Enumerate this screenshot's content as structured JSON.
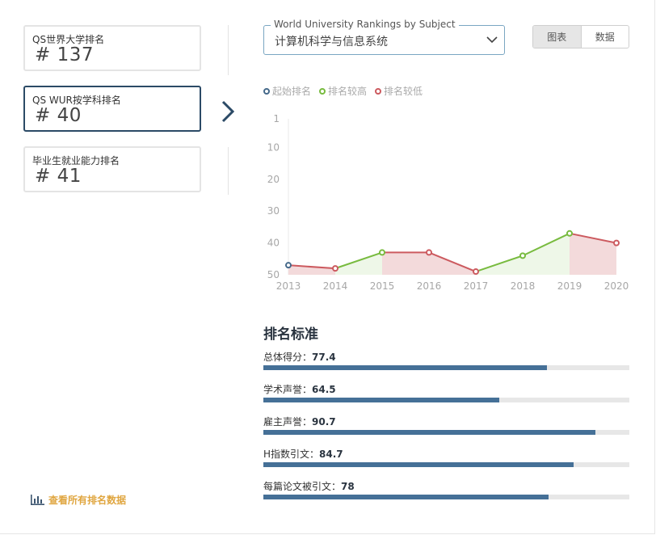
{
  "rank_cards": [
    {
      "label": "QS世界大学排名",
      "value": "# 137"
    },
    {
      "label": "QS WUR按学科排名",
      "value": "# 40"
    },
    {
      "label": "毕业生就业能力排名",
      "value": "# 41"
    }
  ],
  "subject_select": {
    "legend": "World University Rankings by Subject",
    "value": "计算机科学与信息系统"
  },
  "view_toggle": {
    "chart": "图表",
    "data": "数据"
  },
  "chart_legend": {
    "start": "起始排名",
    "higher": "排名较高",
    "lower": "排名较低"
  },
  "colors": {
    "start": "#45698a",
    "higher": "#78bb3f",
    "lower": "#cc5a5f",
    "higher_fill": "#eef7e8",
    "lower_fill": "#f3dadb",
    "bar": "#457097",
    "accent": "#e0a640"
  },
  "chart_data": {
    "type": "line",
    "x": [
      "2013",
      "2014",
      "2015",
      "2016",
      "2017",
      "2018",
      "2019",
      "2020"
    ],
    "values": [
      47,
      48,
      43,
      43,
      49,
      44,
      37,
      40
    ],
    "y_ticks": [
      1,
      10,
      20,
      30,
      40,
      50
    ],
    "ylim": [
      1,
      50
    ],
    "y_inverted": true,
    "title": "",
    "xlabel": "",
    "ylabel": ""
  },
  "criteria": {
    "title": "排名标准",
    "items": [
      {
        "label": "总体得分：",
        "value": "77.4",
        "score": 77.4
      },
      {
        "label": "学术声誉：",
        "value": "64.5",
        "score": 64.5
      },
      {
        "label": "雇主声誉：",
        "value": "90.7",
        "score": 90.7
      },
      {
        "label": "H指数引文：",
        "value": "84.7",
        "score": 84.7
      },
      {
        "label": "每篇论文被引文：",
        "value": "78",
        "score": 78
      }
    ]
  },
  "view_all_link": "查看所有排名数据"
}
